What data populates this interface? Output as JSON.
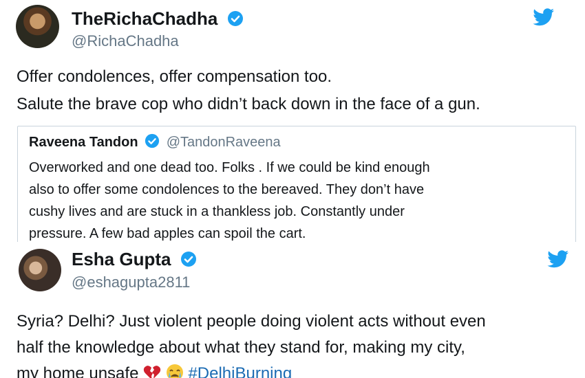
{
  "tweet1": {
    "display_name": "TheRichaChadha",
    "handle": "@RichaChadha",
    "lines": [
      "Offer condolences, offer compensation too.",
      "Salute the brave cop who didn’t back down in the face of a gun."
    ]
  },
  "quote": {
    "display_name": "Raveena Tandon",
    "handle": "@TandonRaveena",
    "lines": [
      "Overworked and one dead too. Folks . If we could be kind enough",
      "also to offer some condolences to the bereaved. They don’t have",
      "cushy lives and are stuck in a thankless job. Constantly under",
      "pressure. A few bad apples can spoil the cart."
    ]
  },
  "tweet2": {
    "display_name": "Esha Gupta",
    "handle": "@eshagupta2811",
    "lines": [
      "Syria? Delhi? Just violent people doing violent acts without even",
      "half the knowledge about what they stand for, making my city,"
    ],
    "last_line_prefix": "my home unsafe",
    "hashtag": "#DelhiBurning"
  },
  "icons": {
    "verified": "verified-badge-icon",
    "twitter": "twitter-bird-icon",
    "broken_heart": "broken-heart-emoji",
    "crying_face": "crying-face-emoji"
  },
  "colors": {
    "verified_blue": "#1da1f2",
    "hashtag_blue": "#1b6bb3",
    "handle_gray": "#657786"
  }
}
